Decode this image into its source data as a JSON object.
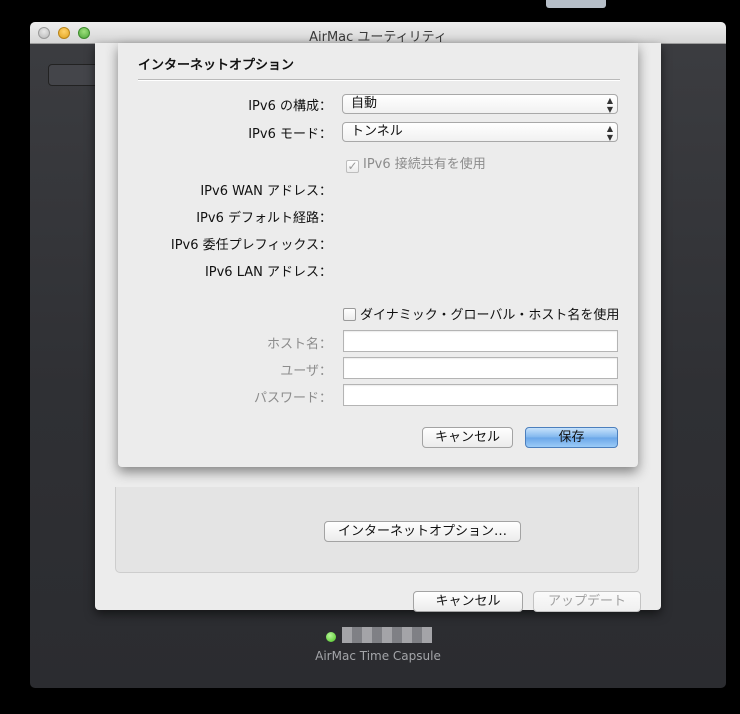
{
  "window": {
    "title": "AirMac ユーティリティ"
  },
  "internet_options_sheet": {
    "title": "インターネットオプション",
    "ipv6_config": {
      "label": "IPv6 の構成：",
      "value": "自動"
    },
    "ipv6_mode": {
      "label": "IPv6 モード：",
      "value": "トンネル"
    },
    "ipv6_sharing_checkbox": {
      "label": "IPv6 接続共有を使用",
      "checked": true,
      "enabled": false
    },
    "ipv6_wan_address_label": "IPv6 WAN アドレス：",
    "ipv6_default_route_label": "IPv6 デフォルト経路：",
    "ipv6_delegated_prefix_label": "IPv6 委任プレフィックス：",
    "ipv6_lan_address_label": "IPv6 LAN アドレス：",
    "dynamic_host_checkbox": {
      "label": "ダイナミック・グローバル・ホスト名を使用",
      "checked": false
    },
    "hostname": {
      "label": "ホスト名：",
      "value": ""
    },
    "user": {
      "label": "ユーザ：",
      "value": ""
    },
    "password": {
      "label": "パスワード：",
      "value": ""
    },
    "cancel_label": "キャンセル",
    "save_label": "保存"
  },
  "base_sheet": {
    "internet_options_button_label": "インターネットオプション…",
    "cancel_label": "キャンセル",
    "update_label": "アップデート"
  },
  "device": {
    "model": "AirMac Time Capsule",
    "status_color": "#49c51f"
  },
  "icons": {
    "popup_arrows": "⬍",
    "checkmark": "✓"
  }
}
